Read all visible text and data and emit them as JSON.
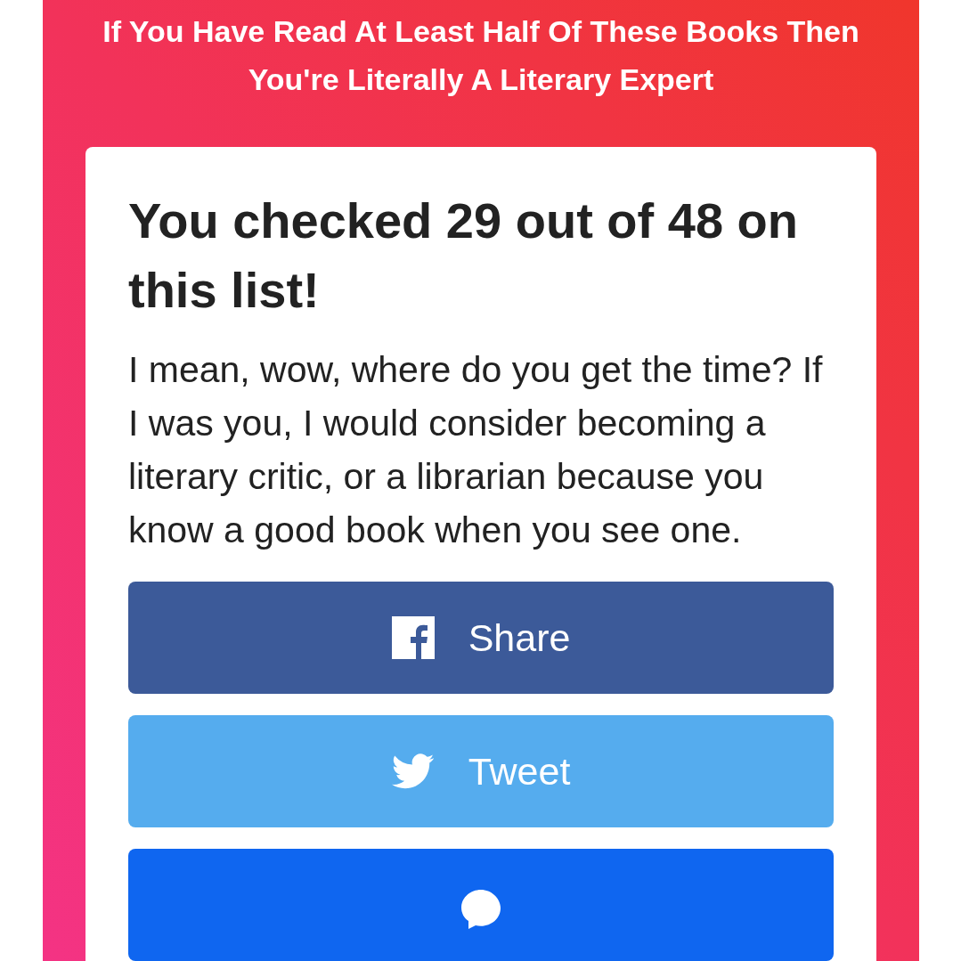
{
  "title": "If You Have Read At Least Half Of These Books Then You're Literally A Literary Expert",
  "result": {
    "heading": "You checked 29 out of 48 on this list!",
    "description": "I mean, wow, where do you get the time? If I was you, I would consider becoming a literary critic, or a librarian because you know a good book when you see one."
  },
  "share_buttons": [
    {
      "kind": "facebook",
      "label": "Share"
    },
    {
      "kind": "twitter",
      "label": "Tweet"
    },
    {
      "kind": "messenger"
    }
  ]
}
